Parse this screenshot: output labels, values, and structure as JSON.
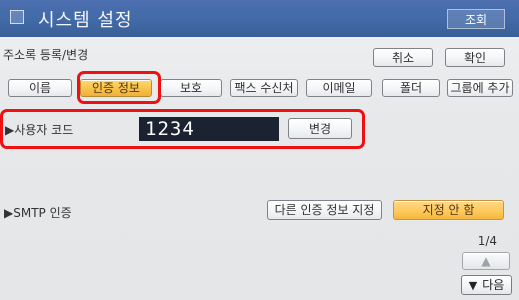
{
  "window": {
    "title": "시스템 설정",
    "title_right": "조회"
  },
  "header": {
    "subtitle": "주소록 등록/변경",
    "cancel_label": "취소",
    "ok_label": "확인"
  },
  "tabs": [
    {
      "label": "이름"
    },
    {
      "label": "인증 정보"
    },
    {
      "label": "보호"
    },
    {
      "label": "팩스 수신처"
    },
    {
      "label": "이메일"
    },
    {
      "label": "폴더"
    },
    {
      "label": "그룹에 추가"
    }
  ],
  "user_code": {
    "label": "▶사용자 코드",
    "value": "1234",
    "change_label": "변경"
  },
  "smtp": {
    "label": "▶SMTP 인증",
    "other_label": "다른 인증 정보 지정",
    "none_label": "지정 안 함"
  },
  "pagination": {
    "page": "1/4",
    "next_label": "다음",
    "up_symbol": "▲",
    "down_symbol": "▼"
  },
  "colors": {
    "titlebar": "#416aa7",
    "active_tab": "#f8c24b",
    "highlight": "#ef1111",
    "code_bg": "#1b2232"
  }
}
